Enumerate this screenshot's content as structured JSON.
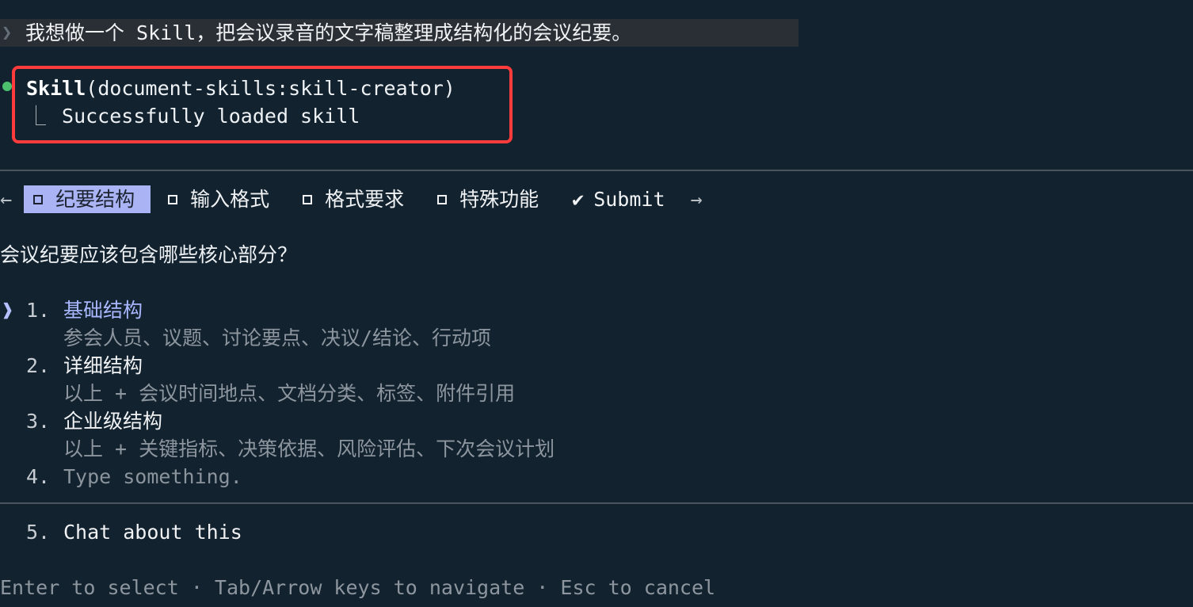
{
  "prompt": {
    "caret": "❯",
    "text": "我想做一个 Skill，把会议录音的文字稿整理成结构化的会议纪要。"
  },
  "skill_call": {
    "name": "Skill",
    "args": "(document-skills:skill-creator)",
    "result_prefix": "⎿",
    "result": "Successfully loaded skill",
    "status_color": "#4cc16e"
  },
  "tabs": {
    "prev_arrow": "←",
    "next_arrow": "→",
    "items": [
      {
        "label": "纪要结构",
        "active": true
      },
      {
        "label": "输入格式",
        "active": false
      },
      {
        "label": "格式要求",
        "active": false
      },
      {
        "label": "特殊功能",
        "active": false
      }
    ],
    "submit_check": "✔",
    "submit_label": "Submit"
  },
  "question": "会议纪要应该包含哪些核心部分？",
  "selector": "❱",
  "options": [
    {
      "num": "1.",
      "title": "基础结构",
      "desc": "参会人员、议题、讨论要点、决议/结论、行动项"
    },
    {
      "num": "2.",
      "title": "详细结构",
      "desc": "以上 + 会议时间地点、文档分类、标签、附件引用"
    },
    {
      "num": "3.",
      "title": "企业级结构",
      "desc": "以上 + 关键指标、决策依据、风险评估、下次会议计划"
    },
    {
      "num": "4.",
      "title": "Type something."
    }
  ],
  "chat_option": {
    "num": "5.",
    "title": "Chat about this"
  },
  "footer": "Enter to select · Tab/Arrow keys to navigate · Esc to cancel",
  "colors": {
    "background": "#12222f",
    "active_tab": "#aab3f3",
    "highlight_border": "#ff3b3b",
    "selected_option": "#a9b7ff"
  }
}
